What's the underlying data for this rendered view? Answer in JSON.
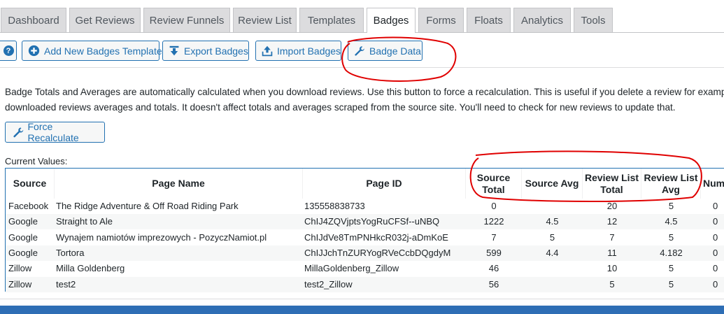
{
  "tabs": [
    {
      "label": "Dashboard"
    },
    {
      "label": "Get Reviews"
    },
    {
      "label": "Review Funnels"
    },
    {
      "label": "Review List"
    },
    {
      "label": "Templates"
    },
    {
      "label": "Badges",
      "active": true
    },
    {
      "label": "Forms"
    },
    {
      "label": "Floats"
    },
    {
      "label": "Analytics"
    },
    {
      "label": "Tools"
    }
  ],
  "toolbar": {
    "help_label": "?",
    "add_label": "Add New Badges Template",
    "export_label": "Export Badges",
    "import_label": "Import Badges",
    "data_label": "Badge Data"
  },
  "description": {
    "line1": "Badge Totals and Averages are automatically calculated when you download reviews. Use this button to force a recalculation. This is useful if you delete a review for example. T",
    "line2": "downloaded reviews averages and totals. It doesn't affect totals and averages scraped from the source site. You'll need to check for new reviews to update that."
  },
  "recalc_label": "Force Recalculate",
  "current_values_label": "Current Values:",
  "table": {
    "headers": {
      "source": "Source",
      "page_name": "Page Name",
      "page_id": "Page ID",
      "source_total": "Source Total",
      "source_avg": "Source Avg",
      "rl_total": "Review List Total",
      "rl_avg": "Review List Avg",
      "num": "Num"
    },
    "rows": [
      {
        "source": "Facebook",
        "page_name": "The Ridge Adventure & Off Road Riding Park",
        "page_id": "135558838733",
        "source_total": "0",
        "source_avg": "",
        "rl_total": "20",
        "rl_avg": "5",
        "num": "0"
      },
      {
        "source": "Google",
        "page_name": "Straight to Ale",
        "page_id": "ChIJ4ZQVjptsYogRuCFSf--uNBQ",
        "source_total": "1222",
        "source_avg": "4.5",
        "rl_total": "12",
        "rl_avg": "4.5",
        "num": "0"
      },
      {
        "source": "Google",
        "page_name": "Wynajem namiotów imprezowych - PozyczNamiot.pl",
        "page_id": "ChIJdVe8TmPNHkcR032j-aDmKoE",
        "source_total": "7",
        "source_avg": "5",
        "rl_total": "7",
        "rl_avg": "5",
        "num": "0"
      },
      {
        "source": "Google",
        "page_name": "Tortora",
        "page_id": "ChIJJchTnZURYogRVeCcbDQgdyM",
        "source_total": "599",
        "source_avg": "4.4",
        "rl_total": "11",
        "rl_avg": "4.182",
        "num": "0"
      },
      {
        "source": "Zillow",
        "page_name": "Milla Goldenberg",
        "page_id": "MillaGoldenberg_Zillow",
        "source_total": "46",
        "source_avg": "",
        "rl_total": "10",
        "rl_avg": "5",
        "num": "0"
      },
      {
        "source": "Zillow",
        "page_name": "test2",
        "page_id": "test2_Zillow",
        "source_total": "56",
        "source_avg": "",
        "rl_total": "5",
        "rl_avg": "5",
        "num": "0"
      }
    ]
  },
  "colors": {
    "accent": "#2271b1",
    "annotation": "#e00000",
    "bottom_bar": "#2e6eb5"
  }
}
